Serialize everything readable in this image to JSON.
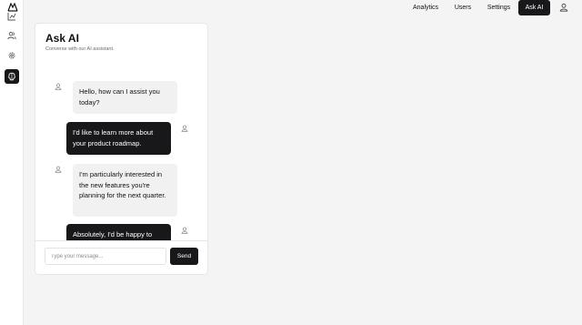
{
  "nav": {
    "items": [
      {
        "label": "Analytics"
      },
      {
        "label": "Users"
      },
      {
        "label": "Settings"
      },
      {
        "label": "Ask AI",
        "active": true
      }
    ]
  },
  "sidebar": {
    "icons": [
      "chart-icon",
      "users-icon",
      "gear-icon",
      "brain-icon"
    ],
    "active": "brain-icon"
  },
  "chat": {
    "title": "Ask AI",
    "subtitle": "Converse with our AI assistant.",
    "messages": [
      {
        "role": "ai",
        "text": "Hello, how can I assist you today?"
      },
      {
        "role": "user",
        "text": "I'd like to learn more about your product roadmap."
      },
      {
        "role": "ai",
        "text": "I'm particularly interested in the new features you're planning for the next quarter."
      },
      {
        "role": "user",
        "text": "Absolutely, I'd be happy to"
      }
    ],
    "input_placeholder": "Type your message...",
    "send_label": "Send"
  },
  "colors": {
    "accent": "#18181b",
    "background": "#f4f4f5",
    "card": "#ffffff",
    "ai_bubble": "#f1f1f2"
  }
}
